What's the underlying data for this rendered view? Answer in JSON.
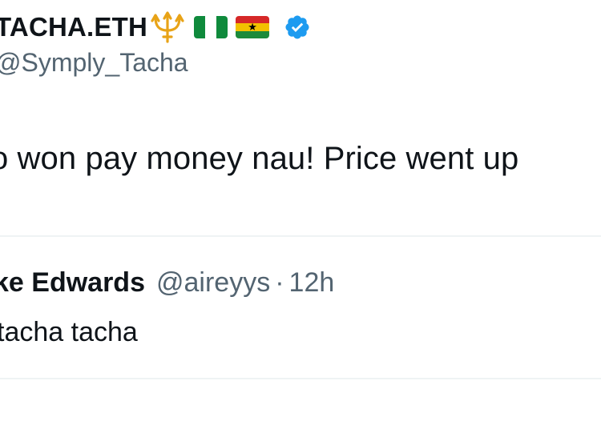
{
  "author": {
    "display_name": "TACHA.ETH",
    "handle": "@Symply_Tacha",
    "badges": [
      "trident-emoji",
      "nigeria-flag",
      "ghana-flag",
      "verified-badge-icon"
    ]
  },
  "tweet": {
    "text": "o won pay money nau! Price went up"
  },
  "quoted": {
    "name": "ke Edwards",
    "handle": "@aireyys",
    "separator": "·",
    "time": "12h",
    "text": "tacha tacha"
  },
  "colors": {
    "text_primary": "#0f1419",
    "text_secondary": "#536471",
    "divider": "#eff3f4",
    "verified_blue": "#1d9bf0",
    "trident_gold": "#e8a317"
  }
}
